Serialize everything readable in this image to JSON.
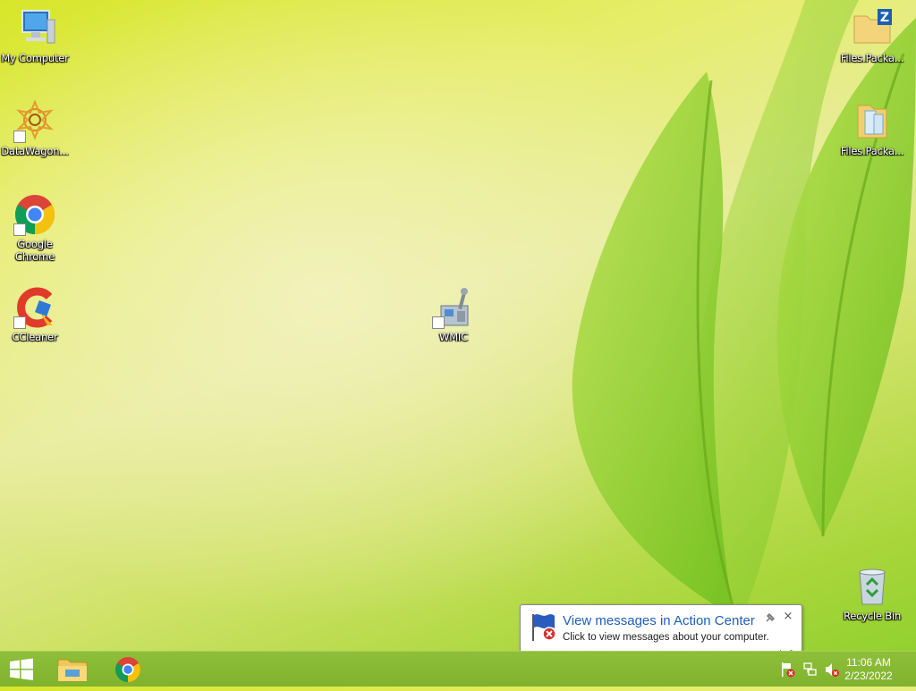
{
  "desktop": {
    "icons": [
      {
        "label": "My Computer",
        "icon": "computer-icon"
      },
      {
        "label": "DataWagon...",
        "icon": "datawagon-icon"
      },
      {
        "label": "Google Chrome",
        "icon": "chrome-icon"
      },
      {
        "label": "CCleaner",
        "icon": "ccleaner-icon"
      },
      {
        "label": "WMIC",
        "icon": "wmic-icon"
      },
      {
        "label": "Files.Packa...",
        "icon": "zip-folder-icon"
      },
      {
        "label": "Files.Packa...",
        "icon": "folder-icon"
      },
      {
        "label": "Recycle Bin",
        "icon": "recycle-bin-icon"
      }
    ]
  },
  "notification": {
    "title": "View messages in Action Center",
    "text": "Click to view messages about your computer.",
    "close": "×"
  },
  "taskbar": {
    "pinned": [
      {
        "name": "file-explorer",
        "icon": "file-explorer-icon"
      },
      {
        "name": "chrome",
        "icon": "chrome-icon"
      }
    ],
    "tray": [
      "action-center-icon",
      "network-icon",
      "volume-muted-icon"
    ],
    "clock": {
      "time": "11:06 AM",
      "date": "2/23/2022"
    }
  },
  "colors": {
    "accent": "#7fb22e",
    "balloon_title": "#1f5ebd"
  }
}
